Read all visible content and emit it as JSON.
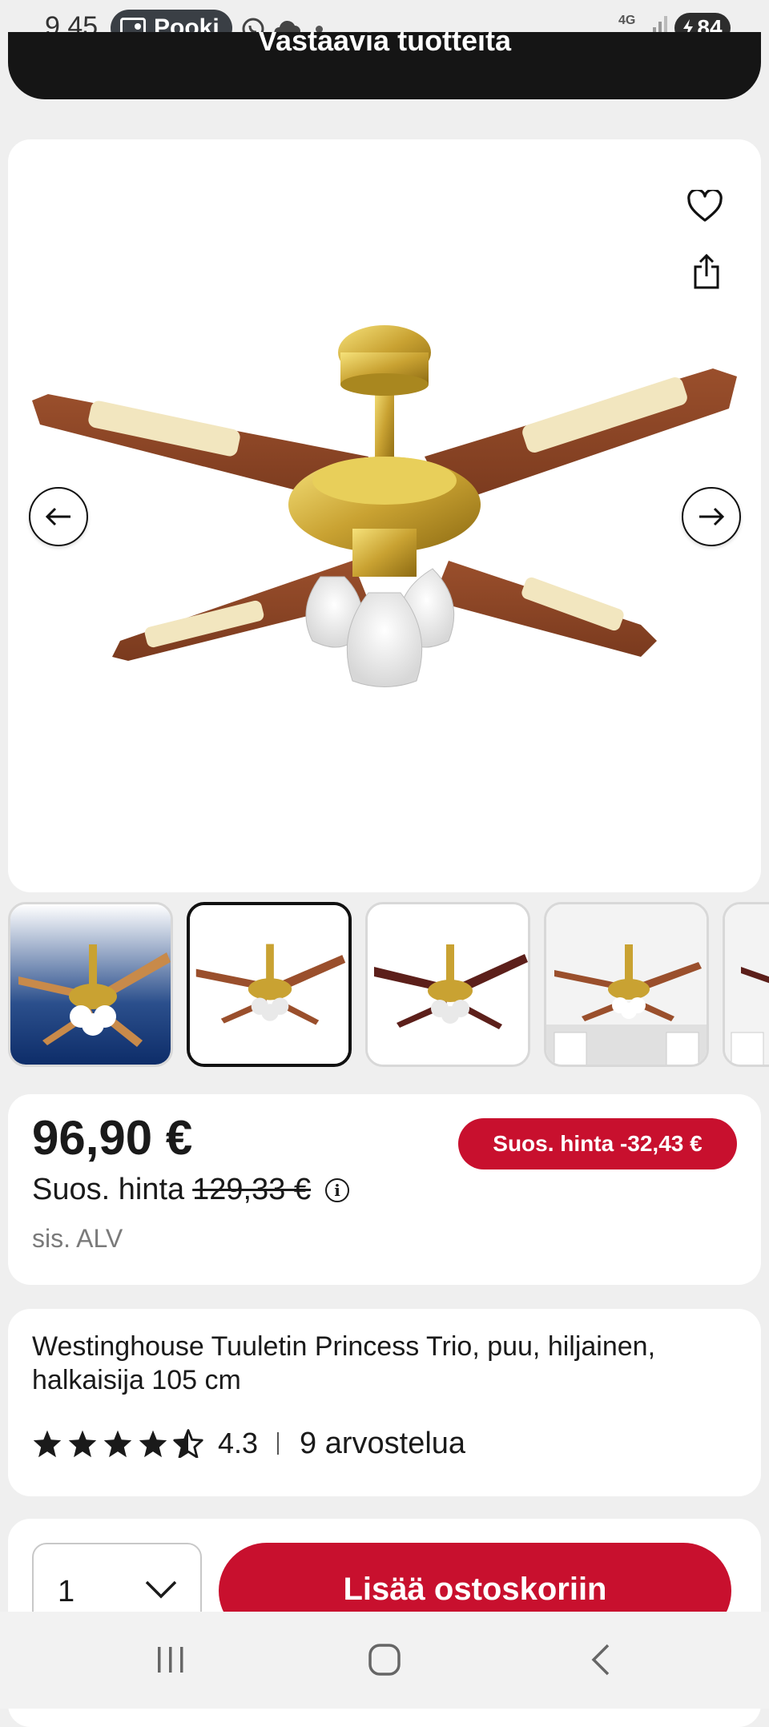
{
  "status_bar": {
    "time": "9.45",
    "app_pill": "Pooki",
    "network": "4G",
    "battery": "84"
  },
  "banner": {
    "text": "Vastaavia tuotteita"
  },
  "gallery": {
    "thumbnails": [
      "thumb-1",
      "thumb-2",
      "thumb-3",
      "thumb-4",
      "thumb-5"
    ],
    "selected_index": 1
  },
  "price": {
    "current": "96,90 €",
    "badge": "Suos. hinta -32,43 €",
    "label": "Suos. hinta",
    "old": "129,33 €",
    "vat": "sis. ALV"
  },
  "product": {
    "title": "Westinghouse Tuuletin Princess Trio, puu, hiljainen, halkaisija 105 cm",
    "rating": 4.3,
    "rating_text": "4.3",
    "reviews": "9 arvostelua"
  },
  "cart": {
    "quantity": "1",
    "add_button": "Lisää ostoskoriin"
  },
  "colors": {
    "accent": "#c8102e",
    "banner": "#151515"
  }
}
